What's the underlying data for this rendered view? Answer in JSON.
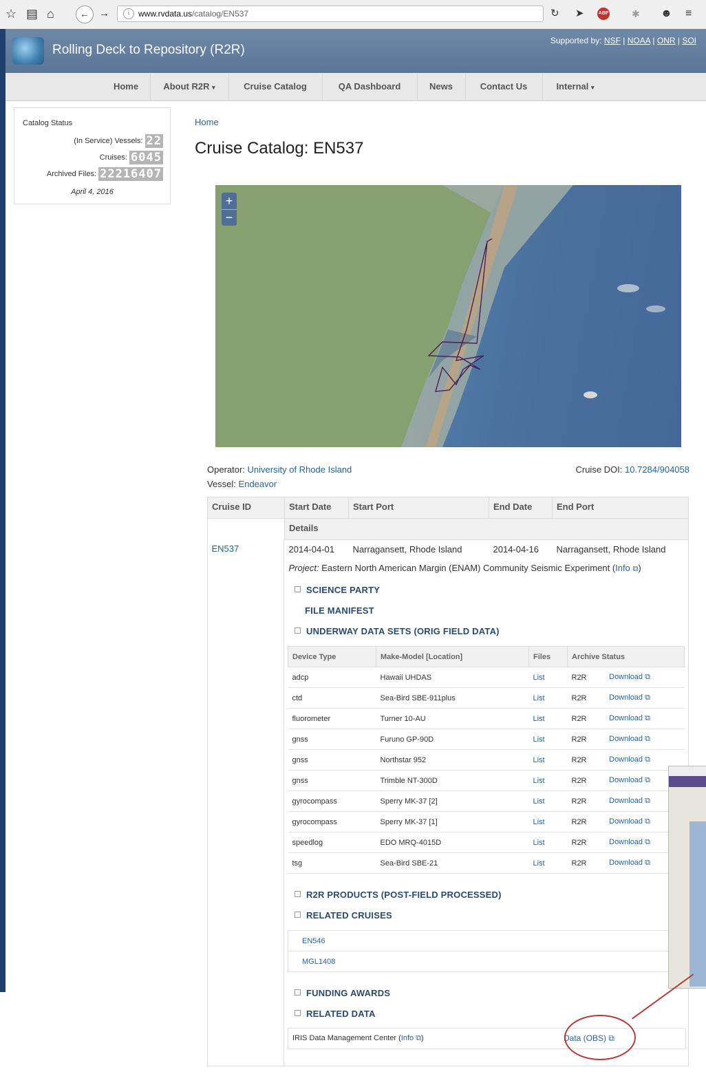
{
  "browser": {
    "url_host": "www.rvdata.us",
    "url_path": "/catalog/EN537"
  },
  "header": {
    "site_title": "Rolling Deck to Repository (R2R)",
    "supported_by_label": "Supported by:",
    "sponsors": [
      "NSF",
      "NOAA",
      "ONR",
      "SOI"
    ]
  },
  "nav": {
    "items": [
      "Home",
      "About R2R",
      "Cruise Catalog",
      "QA Dashboard",
      "News",
      "Contact Us",
      "Internal"
    ]
  },
  "status": {
    "title": "Catalog Status",
    "vessels_label": "(In Service) Vessels:",
    "vessels": "22",
    "cruises_label": "Cruises:",
    "cruises": "6045",
    "files_label": "Archived Files:",
    "files": "22216407",
    "date": "April 4, 2016"
  },
  "page": {
    "breadcrumb": "Home",
    "title": "Cruise Catalog: EN537"
  },
  "map": {
    "zoom_in": "+",
    "zoom_out": "−"
  },
  "meta": {
    "operator_label": "Operator:",
    "operator": "University of Rhode Island",
    "vessel_label": "Vessel:",
    "vessel": "Endeavor",
    "doi_label": "Cruise DOI:",
    "doi": "10.7284/904058"
  },
  "cruise_table": {
    "headers": [
      "Cruise ID",
      "Start Date",
      "Start Port",
      "End Date",
      "End Port"
    ],
    "details_header": "Details",
    "cruise_id": "EN537",
    "start_date": "2014-04-01",
    "start_port": "Narragansett, Rhode Island",
    "end_date": "2014-04-16",
    "end_port": "Narragansett, Rhode Island",
    "project_label": "Project:",
    "project": "Eastern North American Margin (ENAM) Community Seismic Experiment",
    "info_link": "Info"
  },
  "sections": {
    "science_party": "SCIENCE PARTY",
    "file_manifest": "FILE MANIFEST",
    "underway": "UNDERWAY DATA SETS (ORIG FIELD DATA)",
    "products": "R2R PRODUCTS (POST-FIELD PROCESSED)",
    "related_cruises": "RELATED CRUISES",
    "funding": "FUNDING AWARDS",
    "related_data": "RELATED DATA"
  },
  "device_table": {
    "headers": [
      "Device Type",
      "Make-Model [Location]",
      "Files",
      "Archive Status"
    ],
    "rows": [
      {
        "type": "adcp",
        "model": "Hawaii UHDAS",
        "files": "List",
        "archive": "R2R",
        "status": "Download"
      },
      {
        "type": "ctd",
        "model": "Sea-Bird SBE-911plus",
        "files": "List",
        "archive": "R2R",
        "status": "Download"
      },
      {
        "type": "fluorometer",
        "model": "Turner 10-AU",
        "files": "List",
        "archive": "R2R",
        "status": "Download"
      },
      {
        "type": "gnss",
        "model": "Furuno GP-90D",
        "files": "List",
        "archive": "R2R",
        "status": "Download"
      },
      {
        "type": "gnss",
        "model": "Northstar 952",
        "files": "List",
        "archive": "R2R",
        "status": "Download"
      },
      {
        "type": "gnss",
        "model": "Trimble NT-300D",
        "files": "List",
        "archive": "R2R",
        "status": "Download"
      },
      {
        "type": "gyrocompass",
        "model": "Sperry MK-37 [2]",
        "files": "List",
        "archive": "R2R",
        "status": "Download"
      },
      {
        "type": "gyrocompass",
        "model": "Sperry MK-37 [1]",
        "files": "List",
        "archive": "R2R",
        "status": "Download"
      },
      {
        "type": "speedlog",
        "model": "EDO MRQ-4015D",
        "files": "List",
        "archive": "R2R",
        "status": "Download"
      },
      {
        "type": "tsg",
        "model": "Sea-Bird SBE-21",
        "files": "List",
        "archive": "R2R",
        "status": "Download"
      }
    ]
  },
  "related_cruises": [
    "EN546",
    "MGL1408"
  ],
  "related_data": {
    "source": "IRIS Data Management Center",
    "info": "Info",
    "link": "Data (OBS)"
  },
  "colors": {
    "link": "#2a6496",
    "header": "#6f89a9",
    "section": "#2a4a6e",
    "annotation": "#b83b3b"
  }
}
